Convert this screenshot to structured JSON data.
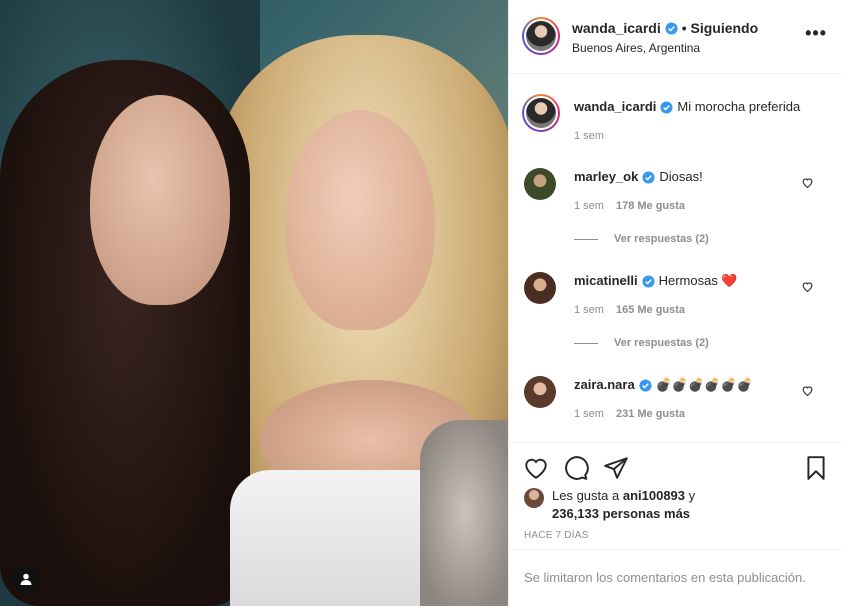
{
  "post": {
    "author": "wanda_icardi",
    "follow_status": "• Siguiendo",
    "location": "Buenos Aires, Argentina",
    "more": "•••"
  },
  "caption": {
    "author": "wanda_icardi",
    "text": "Mi morocha preferida",
    "time": "1 sem"
  },
  "comments": [
    {
      "user": "marley_ok",
      "text": "Diosas!",
      "time": "1 sem",
      "likes": "178 Me gusta",
      "replies": "Ver respuestas (2)"
    },
    {
      "user": "micatinelli",
      "text": "Hermosas ❤️",
      "time": "1 sem",
      "likes": "165 Me gusta",
      "replies": "Ver respuestas (2)"
    },
    {
      "user": "zaira.nara",
      "text": "💣💣💣💣💣💣",
      "time": "1 sem",
      "likes": "231 Me gusta"
    }
  ],
  "likes": {
    "line1_prefix": "Les gusta a",
    "line1_user": "ani100893",
    "line1_suffix": "y",
    "line2": "236,133 personas más"
  },
  "timestamp": "HACE 7 DÍAS",
  "comments_limited": "Se limitaron los comentarios en esta publicación.",
  "colors": {
    "verified": "#3897f0",
    "muted": "#8e8e8e",
    "border": "#efefef",
    "heart_red": "#e0245e"
  }
}
